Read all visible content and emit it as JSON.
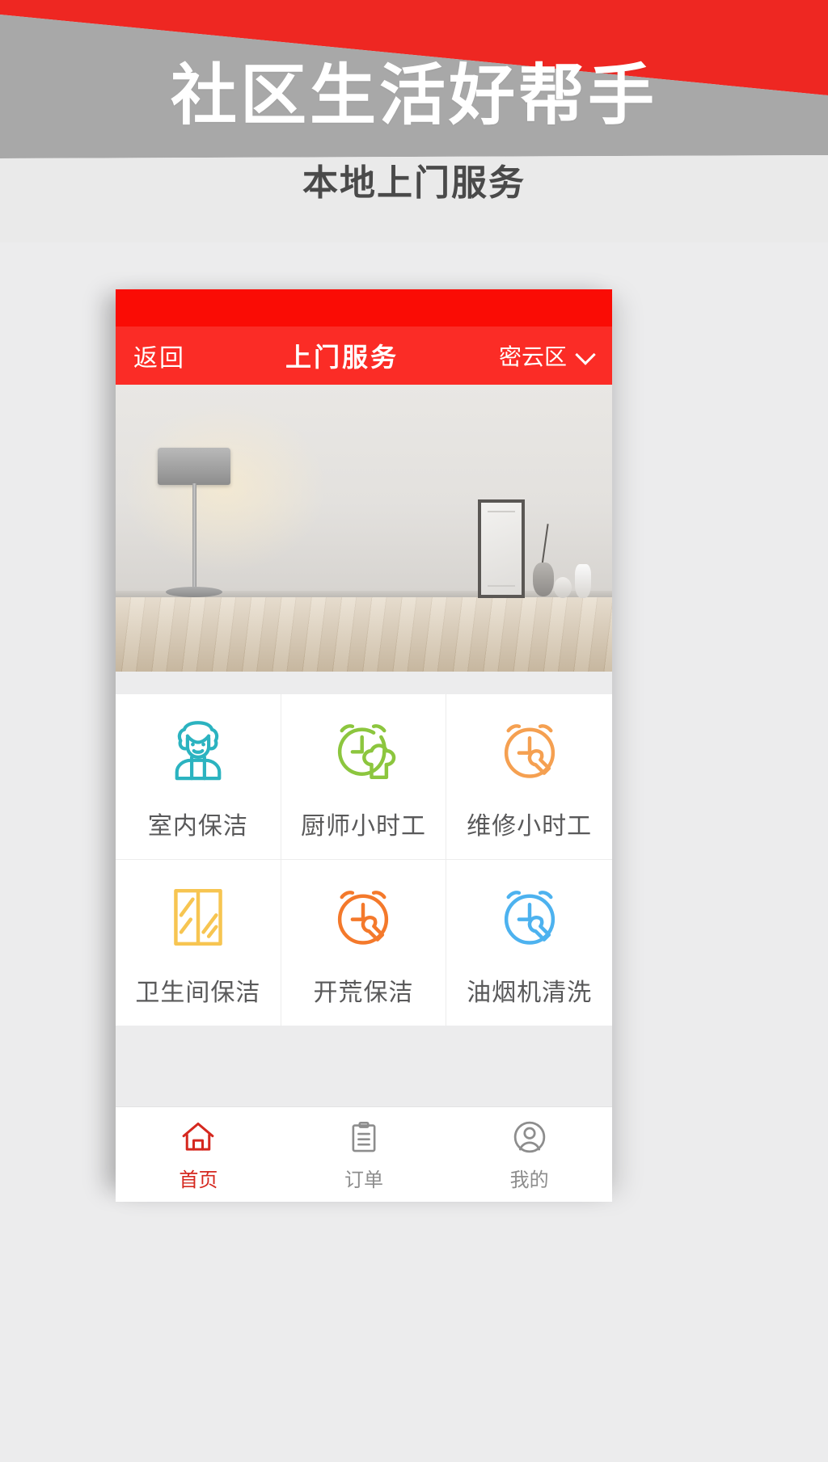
{
  "hero": {
    "title": "社区生活好帮手",
    "subtitle": "本地上门服务",
    "colors": {
      "red": "#ee2722",
      "gray": "#a8a8a8",
      "light": "#eaeaea"
    }
  },
  "phone": {
    "nav": {
      "back_label": "返回",
      "title": "上门服务",
      "district": "密云区",
      "chevron_icon": "chevron-down-icon",
      "bar_color": "#fb2c26"
    },
    "banner": {
      "alt": "室内木地板与落地灯效果图"
    },
    "services": [
      {
        "label": "室内保洁",
        "icon": "maid-icon",
        "color": "#2bb3c0"
      },
      {
        "label": "厨师小时工",
        "icon": "clock-chef-hat-icon",
        "color": "#8cc63e"
      },
      {
        "label": "维修小时工",
        "icon": "clock-wrench-icon",
        "color": "#f5a051"
      },
      {
        "label": "卫生间保洁",
        "icon": "window-icon",
        "color": "#f7c551"
      },
      {
        "label": "开荒保洁",
        "icon": "clock-wrench-icon",
        "color": "#f4792b"
      },
      {
        "label": "油烟机清洗",
        "icon": "clock-wrench-icon",
        "color": "#4db2ef"
      }
    ],
    "tabs": [
      {
        "label": "首页",
        "icon": "home-icon",
        "active": true,
        "color": "#d5281f"
      },
      {
        "label": "订单",
        "icon": "clipboard-icon",
        "active": false,
        "color": "#8d8d8d"
      },
      {
        "label": "我的",
        "icon": "person-icon",
        "active": false,
        "color": "#8d8d8d"
      }
    ]
  }
}
